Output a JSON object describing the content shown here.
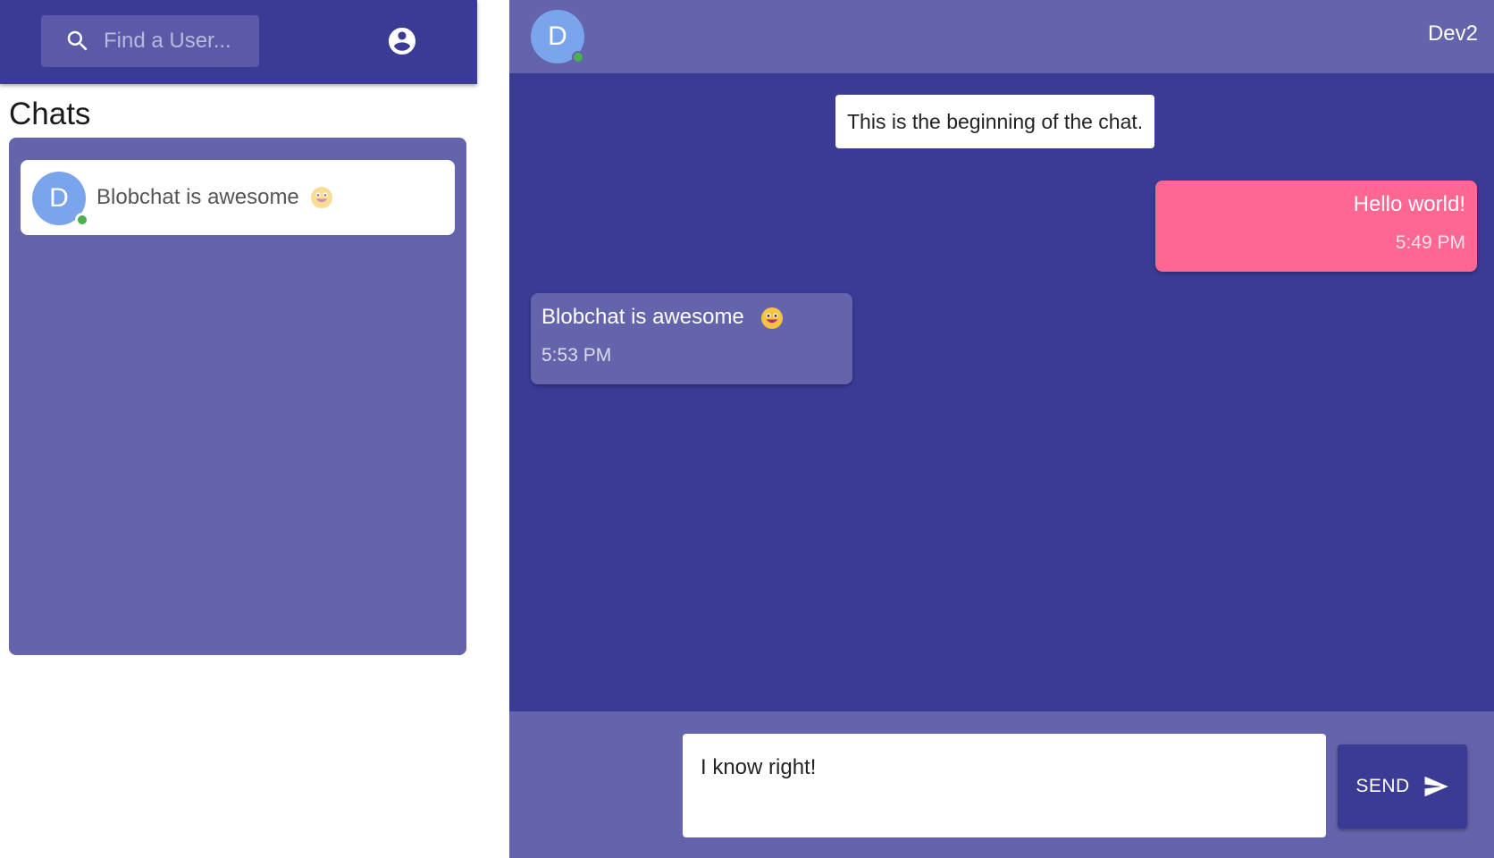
{
  "search": {
    "placeholder": "Find a User..."
  },
  "sidebar": {
    "title": "Chats",
    "chats": [
      {
        "avatar_letter": "D",
        "online": true,
        "preview": "Blobchat is awesome",
        "preview_emoji": "grinning-face-emoji"
      }
    ]
  },
  "header": {
    "avatar_letter": "D",
    "online": true,
    "contact_name": "Dev2"
  },
  "messages": {
    "system_note": "This is the beginning of the chat.",
    "items": [
      {
        "direction": "outgoing",
        "text": "Hello world!",
        "time": "5:49 PM"
      },
      {
        "direction": "incoming",
        "text": "Blobchat is awesome",
        "emoji": "grinning-face-emoji",
        "time": "5:53 PM"
      }
    ]
  },
  "composer": {
    "value": "I know right!",
    "send_label": "SEND"
  },
  "colors": {
    "primary": "#3b3b96",
    "primary_light": "#6464ac",
    "outgoing_bubble": "#fe6694",
    "avatar": "#7aa4ec",
    "online": "#4caf50"
  }
}
